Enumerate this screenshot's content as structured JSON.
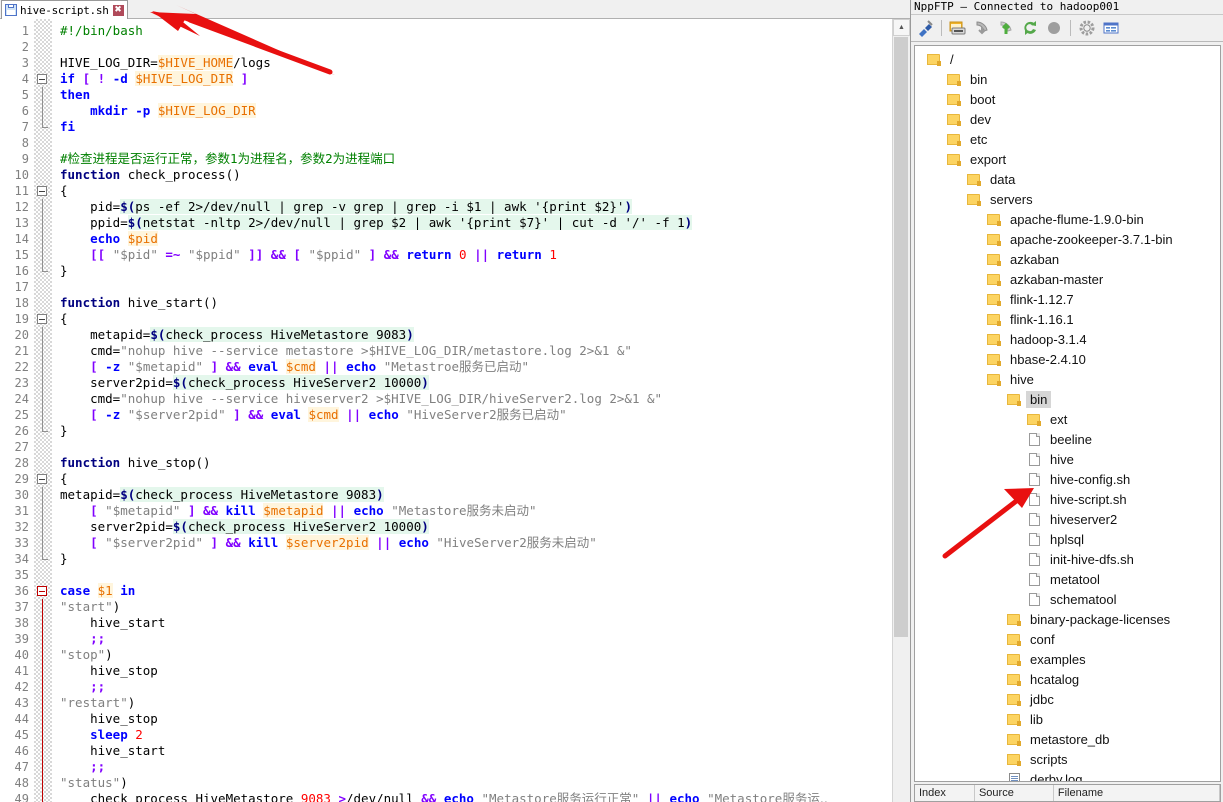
{
  "editor": {
    "tab": {
      "label": "hive-script.sh",
      "save_icon": "save-icon",
      "close_label": "✖"
    },
    "lines": [
      {
        "n": 1,
        "fold": null,
        "html": "<span class='c-cmt'>#!/bin/bash</span>"
      },
      {
        "n": 2,
        "fold": null,
        "html": ""
      },
      {
        "n": 3,
        "fold": null,
        "html": "<span class='c-plain'>HIVE_LOG_DIR=</span><span class='c-var'>$HIVE_HOME</span><span class='c-plain'>/logs</span>"
      },
      {
        "n": 4,
        "fold": "open",
        "html": "<span class='c-kw'>if</span><span class='c-plain'> </span><span class='c-op'>[</span><span class='c-plain'> </span><span class='c-op'>!</span><span class='c-plain'> </span><span class='c-kw'>-d</span><span class='c-plain'> </span><span class='c-var'>$HIVE_LOG_DIR</span><span class='c-plain'> </span><span class='c-op'>]</span>"
      },
      {
        "n": 5,
        "fold": "line",
        "html": "<span class='c-kw'>then</span>"
      },
      {
        "n": 6,
        "fold": "line",
        "html": "<span class='c-plain'>    </span><span class='c-kw'>mkdir</span><span class='c-plain'> </span><span class='c-kw'>-p</span><span class='c-plain'> </span><span class='c-var'>$HIVE_LOG_DIR</span>"
      },
      {
        "n": 7,
        "fold": "end",
        "html": "<span class='c-kw'>fi</span>"
      },
      {
        "n": 8,
        "fold": null,
        "html": ""
      },
      {
        "n": 9,
        "fold": null,
        "html": "<span class='c-cmt'>#<span class='c-cn'>检查进程是否运行正常，参数</span>1<span class='c-cn'>为进程名，参数</span>2<span class='c-cn'>为进程端口</span></span>"
      },
      {
        "n": 10,
        "fold": null,
        "html": "<span class='c-fn'>function</span><span class='c-plain'> check_process()</span>"
      },
      {
        "n": 11,
        "fold": "open",
        "html": "<span class='c-plain'>{</span>"
      },
      {
        "n": 12,
        "fold": "line",
        "html": "<span class='c-plain'>    pid=</span><span class='c-subk'>$(</span><span class='c-sub'>ps -ef 2&gt;/dev/null | grep -v grep | grep -i $1 | awk '{print $2}'</span><span class='c-subk'>)</span>"
      },
      {
        "n": 13,
        "fold": "line",
        "html": "<span class='c-plain'>    ppid=</span><span class='c-subk'>$(</span><span class='c-sub'>netstat -nltp 2&gt;/dev/null | grep $2 | awk '{print $7}' | cut -d '/' -f 1</span><span class='c-subk'>)</span>"
      },
      {
        "n": 14,
        "fold": "line",
        "html": "<span class='c-plain'>    </span><span class='c-kw'>echo</span><span class='c-plain'> </span><span class='c-var'>$pid</span>"
      },
      {
        "n": 15,
        "fold": "line",
        "html": "<span class='c-plain'>    </span><span class='c-op'>[[</span><span class='c-plain'> </span><span class='c-str'>\"$pid\"</span><span class='c-plain'> </span><span class='c-op'>=~</span><span class='c-plain'> </span><span class='c-str'>\"$ppid\"</span><span class='c-plain'> </span><span class='c-op'>]]</span><span class='c-plain'> </span><span class='c-op'>&amp;&amp;</span><span class='c-plain'> </span><span class='c-op'>[</span><span class='c-plain'> </span><span class='c-str'>\"$ppid\"</span><span class='c-plain'> </span><span class='c-op'>]</span><span class='c-plain'> </span><span class='c-op'>&amp;&amp;</span><span class='c-plain'> </span><span class='c-kw'>return</span><span class='c-plain'> </span><span class='c-num'>0</span><span class='c-plain'> </span><span class='c-op'>||</span><span class='c-plain'> </span><span class='c-kw'>return</span><span class='c-plain'> </span><span class='c-num'>1</span>"
      },
      {
        "n": 16,
        "fold": "end",
        "html": "<span class='c-plain'>}</span>"
      },
      {
        "n": 17,
        "fold": null,
        "html": ""
      },
      {
        "n": 18,
        "fold": null,
        "html": "<span class='c-fn'>function</span><span class='c-plain'> hive_start()</span>"
      },
      {
        "n": 19,
        "fold": "open",
        "html": "<span class='c-plain'>{</span>"
      },
      {
        "n": 20,
        "fold": "line",
        "html": "<span class='c-plain'>    metapid=</span><span class='c-subk'>$(</span><span class='c-sub'>check_process HiveMetastore 9083</span><span class='c-subk'>)</span>"
      },
      {
        "n": 21,
        "fold": "line",
        "html": "<span class='c-plain'>    cmd=</span><span class='c-str'>\"nohup hive --service metastore &gt;$HIVE_LOG_DIR/metastore.log 2&gt;&amp;1 &amp;\"</span>"
      },
      {
        "n": 22,
        "fold": "line",
        "html": "<span class='c-plain'>    </span><span class='c-op'>[</span><span class='c-plain'> </span><span class='c-kw'>-z</span><span class='c-plain'> </span><span class='c-str'>\"$metapid\"</span><span class='c-plain'> </span><span class='c-op'>]</span><span class='c-plain'> </span><span class='c-op'>&amp;&amp;</span><span class='c-plain'> </span><span class='c-kw'>eval</span><span class='c-plain'> </span><span class='c-var'>$cmd</span><span class='c-plain'> </span><span class='c-op'>||</span><span class='c-plain'> </span><span class='c-kw'>echo</span><span class='c-plain'> </span><span class='c-str'>\"Metastroe<span class='c-cn'>服务已启动</span>\"</span>"
      },
      {
        "n": 23,
        "fold": "line",
        "html": "<span class='c-plain'>    server2pid=</span><span class='c-subk'>$(</span><span class='c-sub'>check_process HiveServer2 10000</span><span class='c-subk'>)</span>"
      },
      {
        "n": 24,
        "fold": "line",
        "html": "<span class='c-plain'>    cmd=</span><span class='c-str'>\"nohup hive --service hiveserver2 &gt;$HIVE_LOG_DIR/hiveServer2.log 2&gt;&amp;1 &amp;\"</span>"
      },
      {
        "n": 25,
        "fold": "line",
        "html": "<span class='c-plain'>    </span><span class='c-op'>[</span><span class='c-plain'> </span><span class='c-kw'>-z</span><span class='c-plain'> </span><span class='c-str'>\"$server2pid\"</span><span class='c-plain'> </span><span class='c-op'>]</span><span class='c-plain'> </span><span class='c-op'>&amp;&amp;</span><span class='c-plain'> </span><span class='c-kw'>eval</span><span class='c-plain'> </span><span class='c-var'>$cmd</span><span class='c-plain'> </span><span class='c-op'>||</span><span class='c-plain'> </span><span class='c-kw'>echo</span><span class='c-plain'> </span><span class='c-str'>\"HiveServer2<span class='c-cn'>服务已启动</span>\"</span>"
      },
      {
        "n": 26,
        "fold": "end",
        "html": "<span class='c-plain'>}</span>"
      },
      {
        "n": 27,
        "fold": null,
        "html": ""
      },
      {
        "n": 28,
        "fold": null,
        "html": "<span class='c-fn'>function</span><span class='c-plain'> hive_stop()</span>"
      },
      {
        "n": 29,
        "fold": "open",
        "html": "<span class='c-plain'>{</span>"
      },
      {
        "n": 30,
        "fold": "line",
        "html": "<span class='c-plain'>metapid=</span><span class='c-subk'>$(</span><span class='c-sub'>check_process HiveMetastore 9083</span><span class='c-subk'>)</span>"
      },
      {
        "n": 31,
        "fold": "line",
        "html": "<span class='c-plain'>    </span><span class='c-op'>[</span><span class='c-plain'> </span><span class='c-str'>\"$metapid\"</span><span class='c-plain'> </span><span class='c-op'>]</span><span class='c-plain'> </span><span class='c-op'>&amp;&amp;</span><span class='c-plain'> </span><span class='c-kw'>kill</span><span class='c-plain'> </span><span class='c-var'>$metapid</span><span class='c-plain'> </span><span class='c-op'>||</span><span class='c-plain'> </span><span class='c-kw'>echo</span><span class='c-plain'> </span><span class='c-str'>\"Metastore<span class='c-cn'>服务未启动</span>\"</span>"
      },
      {
        "n": 32,
        "fold": "line",
        "html": "<span class='c-plain'>    server2pid=</span><span class='c-subk'>$(</span><span class='c-sub'>check_process HiveServer2 10000</span><span class='c-subk'>)</span>"
      },
      {
        "n": 33,
        "fold": "line",
        "html": "<span class='c-plain'>    </span><span class='c-op'>[</span><span class='c-plain'> </span><span class='c-str'>\"$server2pid\"</span><span class='c-plain'> </span><span class='c-op'>]</span><span class='c-plain'> </span><span class='c-op'>&amp;&amp;</span><span class='c-plain'> </span><span class='c-kw'>kill</span><span class='c-plain'> </span><span class='c-var'>$server2pid</span><span class='c-plain'> </span><span class='c-op'>||</span><span class='c-plain'> </span><span class='c-kw'>echo</span><span class='c-plain'> </span><span class='c-str'>\"HiveServer2<span class='c-cn'>服务未启动</span>\"</span>"
      },
      {
        "n": 34,
        "fold": "end",
        "html": "<span class='c-plain'>}</span>"
      },
      {
        "n": 35,
        "fold": null,
        "html": ""
      },
      {
        "n": 36,
        "fold": "openred",
        "html": "<span class='c-kw'>case</span><span class='c-plain'> </span><span class='c-var'>$1</span><span class='c-plain'> </span><span class='c-kw'>in</span>"
      },
      {
        "n": 37,
        "fold": "linered",
        "html": "<span class='c-str'>\"start\"</span><span class='c-plain'>)</span>"
      },
      {
        "n": 38,
        "fold": "linered",
        "html": "<span class='c-plain'>    hive_start</span>"
      },
      {
        "n": 39,
        "fold": "linered",
        "html": "<span class='c-plain'>    </span><span class='c-op'>;;</span>"
      },
      {
        "n": 40,
        "fold": "linered",
        "html": "<span class='c-str'>\"stop\"</span><span class='c-plain'>)</span>"
      },
      {
        "n": 41,
        "fold": "linered",
        "html": "<span class='c-plain'>    hive_stop</span>"
      },
      {
        "n": 42,
        "fold": "linered",
        "html": "<span class='c-plain'>    </span><span class='c-op'>;;</span>"
      },
      {
        "n": 43,
        "fold": "linered",
        "html": "<span class='c-str'>\"restart\"</span><span class='c-plain'>)</span>"
      },
      {
        "n": 44,
        "fold": "linered",
        "html": "<span class='c-plain'>    hive_stop</span>"
      },
      {
        "n": 45,
        "fold": "linered",
        "html": "<span class='c-plain'>    </span><span class='c-kw'>sleep</span><span class='c-plain'> </span><span class='c-num'>2</span>"
      },
      {
        "n": 46,
        "fold": "linered",
        "html": "<span class='c-plain'>    hive_start</span>"
      },
      {
        "n": 47,
        "fold": "linered",
        "html": "<span class='c-plain'>    </span><span class='c-op'>;;</span>"
      },
      {
        "n": 48,
        "fold": "linered",
        "html": "<span class='c-str'>\"status\"</span><span class='c-plain'>)</span>"
      },
      {
        "n": 49,
        "fold": "linered",
        "html": "<span class='c-plain'>    check_process HiveMetastore </span><span class='c-num'>9083</span><span class='c-plain'> </span><span class='c-op'>&gt;</span><span class='c-plain'>/dev/null </span><span class='c-op'>&amp;&amp;</span><span class='c-plain'> </span><span class='c-kw'>echo</span><span class='c-plain'> </span><span class='c-str'>\"Metastore<span class='c-cn'>服务运行正常</span>\"</span><span class='c-plain'> </span><span class='c-op'>||</span><span class='c-plain'> </span><span class='c-kw'>echo</span><span class='c-plain'> </span><span class='c-str'>\"Metastore<span class='c-cn'>服务运..</span></span>"
      }
    ],
    "scrollbar": {
      "up_arrow": "▲",
      "thumb": "scroll-thumb"
    }
  },
  "ftp": {
    "title": "NppFTP – Connected to hadoop001",
    "toolbar": [
      {
        "name": "connect-icon",
        "glyph": "⚡"
      },
      {
        "name": "open-folder-icon",
        "glyph": "🗁"
      },
      {
        "name": "download-icon",
        "glyph": "↓"
      },
      {
        "name": "upload-icon",
        "glyph": "↑"
      },
      {
        "name": "refresh-icon",
        "glyph": "↻"
      },
      {
        "name": "abort-icon",
        "glyph": "●"
      },
      {
        "name": "settings-icon",
        "glyph": "⚙"
      },
      {
        "name": "messages-icon",
        "glyph": "☰"
      }
    ],
    "tree": [
      {
        "label": "/",
        "indent": 0,
        "type": "folder",
        "selected": false
      },
      {
        "label": "bin",
        "indent": 1,
        "type": "folder",
        "selected": false
      },
      {
        "label": "boot",
        "indent": 1,
        "type": "folder",
        "selected": false
      },
      {
        "label": "dev",
        "indent": 1,
        "type": "folder",
        "selected": false
      },
      {
        "label": "etc",
        "indent": 1,
        "type": "folder",
        "selected": false
      },
      {
        "label": "export",
        "indent": 1,
        "type": "folder",
        "selected": false
      },
      {
        "label": "data",
        "indent": 2,
        "type": "folder",
        "selected": false
      },
      {
        "label": "servers",
        "indent": 2,
        "type": "folder",
        "selected": false
      },
      {
        "label": "apache-flume-1.9.0-bin",
        "indent": 3,
        "type": "folder",
        "selected": false
      },
      {
        "label": "apache-zookeeper-3.7.1-bin",
        "indent": 3,
        "type": "folder",
        "selected": false
      },
      {
        "label": "azkaban",
        "indent": 3,
        "type": "folder",
        "selected": false
      },
      {
        "label": "azkaban-master",
        "indent": 3,
        "type": "folder",
        "selected": false
      },
      {
        "label": "flink-1.12.7",
        "indent": 3,
        "type": "folder",
        "selected": false
      },
      {
        "label": "flink-1.16.1",
        "indent": 3,
        "type": "folder",
        "selected": false
      },
      {
        "label": "hadoop-3.1.4",
        "indent": 3,
        "type": "folder",
        "selected": false
      },
      {
        "label": "hbase-2.4.10",
        "indent": 3,
        "type": "folder",
        "selected": false
      },
      {
        "label": "hive",
        "indent": 3,
        "type": "folder",
        "selected": false
      },
      {
        "label": "bin",
        "indent": 4,
        "type": "folder",
        "selected": true
      },
      {
        "label": "ext",
        "indent": 5,
        "type": "folder",
        "selected": false
      },
      {
        "label": "beeline",
        "indent": 5,
        "type": "file",
        "selected": false
      },
      {
        "label": "hive",
        "indent": 5,
        "type": "file",
        "selected": false
      },
      {
        "label": "hive-config.sh",
        "indent": 5,
        "type": "file",
        "selected": false
      },
      {
        "label": "hive-script.sh",
        "indent": 5,
        "type": "file",
        "selected": false
      },
      {
        "label": "hiveserver2",
        "indent": 5,
        "type": "file",
        "selected": false
      },
      {
        "label": "hplsql",
        "indent": 5,
        "type": "file",
        "selected": false
      },
      {
        "label": "init-hive-dfs.sh",
        "indent": 5,
        "type": "file",
        "selected": false
      },
      {
        "label": "metatool",
        "indent": 5,
        "type": "file",
        "selected": false
      },
      {
        "label": "schematool",
        "indent": 5,
        "type": "file",
        "selected": false
      },
      {
        "label": "binary-package-licenses",
        "indent": 4,
        "type": "folder",
        "selected": false
      },
      {
        "label": "conf",
        "indent": 4,
        "type": "folder",
        "selected": false
      },
      {
        "label": "examples",
        "indent": 4,
        "type": "folder",
        "selected": false
      },
      {
        "label": "hcatalog",
        "indent": 4,
        "type": "folder",
        "selected": false
      },
      {
        "label": "jdbc",
        "indent": 4,
        "type": "folder",
        "selected": false
      },
      {
        "label": "lib",
        "indent": 4,
        "type": "folder",
        "selected": false
      },
      {
        "label": "metastore_db",
        "indent": 4,
        "type": "folder",
        "selected": false
      },
      {
        "label": "scripts",
        "indent": 4,
        "type": "folder",
        "selected": false
      },
      {
        "label": "derby.log",
        "indent": 4,
        "type": "doc",
        "selected": false
      }
    ],
    "bottom_columns": [
      "Index",
      "Source",
      "Filename"
    ]
  },
  "annotations": {
    "arrow_tab": "red-arrow-pointing-to-tab",
    "arrow_file": "red-arrow-pointing-to-hive-script-file"
  },
  "colors": {
    "accent_red": "#e81010",
    "folder": "#fcd462",
    "selection": "#d6d6d6",
    "comment_green": "#008000",
    "keyword_blue": "#0000ff",
    "variable_orange": "#e87000"
  }
}
